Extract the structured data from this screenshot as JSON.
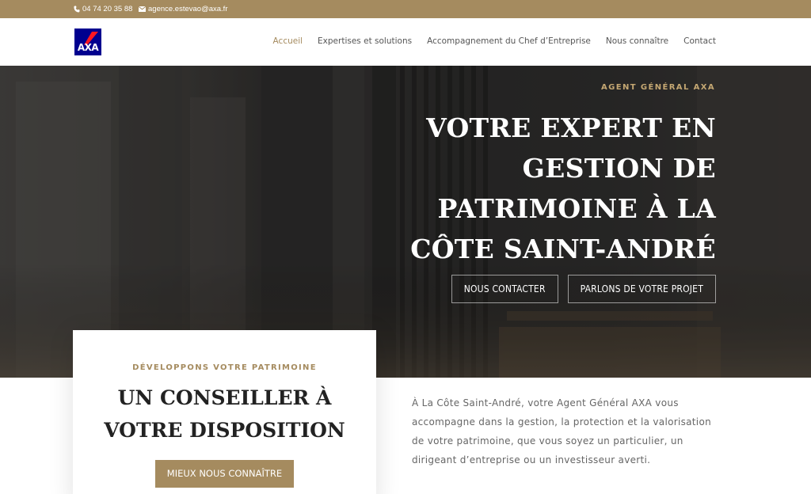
{
  "topbar": {
    "phone": "04 74 20 35 88",
    "phone_icon": "phone-icon",
    "email": "agence.estevao@axa.fr",
    "email_icon": "envelope-icon"
  },
  "header": {
    "logo_text": "AXA",
    "nav": [
      {
        "label": "Accueil",
        "active": true
      },
      {
        "label": "Expertises et solutions"
      },
      {
        "label": "Accompagnement du Chef d’Entreprise"
      },
      {
        "label": "Nous connaître"
      },
      {
        "label": "Contact"
      }
    ]
  },
  "hero": {
    "tag": "AGENT GÉNÉRAL AXA",
    "title_lines": [
      "VOTRE EXPERT EN",
      "GESTION DE",
      "PATRIMOINE À LA",
      "CÔTE SAINT-ANDRÉ"
    ],
    "button_contact": "NOUS CONTACTER",
    "button_project": "PARLONS DE VOTRE PROJET"
  },
  "card": {
    "tag": "DÉVELOPPONS VOTRE PATRIMOINE",
    "title_lines": [
      "UN CONSEILLER À",
      "VOTRE DISPOSITION"
    ],
    "button": "MIEUX NOUS CONNAÎTRE"
  },
  "intro": {
    "text": "À La Côte Saint-André, votre Agent Général AXA vous accompagne dans la gestion, la protection et la valorisation de votre patrimoine, que vous soyez un particulier, un dirigeant d’entreprise ou un investisseur averti."
  },
  "colors": {
    "accent": "#a58b5f",
    "accent_light": "#c4a772",
    "axa_blue": "#00008f",
    "axa_red": "#ff1721"
  }
}
